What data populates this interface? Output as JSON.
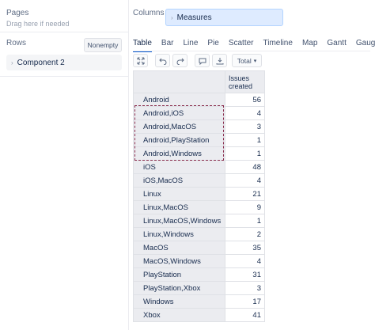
{
  "pages": {
    "title": "Pages",
    "hint": "Drag here if needed"
  },
  "rows": {
    "title": "Rows",
    "nonempty_label": "Nonempty",
    "items": [
      {
        "label": "Component 2"
      }
    ]
  },
  "columns": {
    "title": "Columns",
    "items": [
      {
        "label": "Measures"
      }
    ]
  },
  "tabs": [
    "Table",
    "Bar",
    "Line",
    "Pie",
    "Scatter",
    "Timeline",
    "Map",
    "Gantt",
    "Gauge"
  ],
  "toolbar": {
    "total_label": "Total"
  },
  "table": {
    "header": "Issues created",
    "rows": [
      {
        "label": "Android",
        "value": "56"
      },
      {
        "label": "Android,iOS",
        "value": "4"
      },
      {
        "label": "Android,MacOS",
        "value": "3"
      },
      {
        "label": "Android,PlayStation",
        "value": "1"
      },
      {
        "label": "Android,Windows",
        "value": "1"
      },
      {
        "label": "iOS",
        "value": "48"
      },
      {
        "label": "iOS,MacOS",
        "value": "4"
      },
      {
        "label": "Linux",
        "value": "21"
      },
      {
        "label": "Linux,MacOS",
        "value": "9"
      },
      {
        "label": "Linux,MacOS,Windows",
        "value": "1"
      },
      {
        "label": "Linux,Windows",
        "value": "2"
      },
      {
        "label": "MacOS",
        "value": "35"
      },
      {
        "label": "MacOS,Windows",
        "value": "4"
      },
      {
        "label": "PlayStation",
        "value": "31"
      },
      {
        "label": "PlayStation,Xbox",
        "value": "3"
      },
      {
        "label": "Windows",
        "value": "17"
      },
      {
        "label": "Xbox",
        "value": "41"
      }
    ]
  },
  "colors": {
    "accent": "#0052cc",
    "highlight": "#8a2d4d",
    "chip": "#deebff"
  }
}
